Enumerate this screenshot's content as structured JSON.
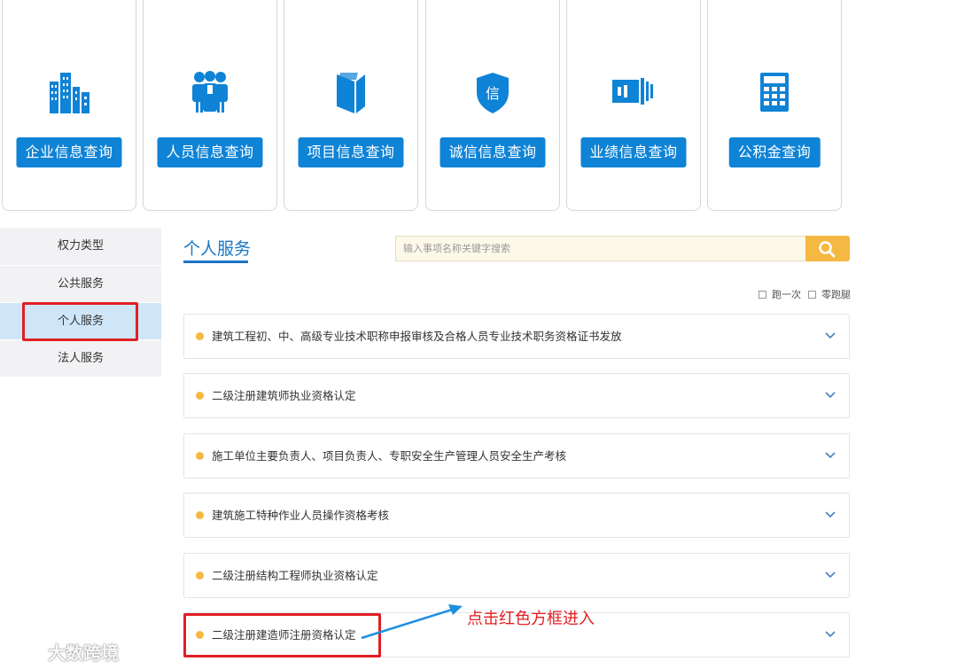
{
  "cards": [
    {
      "label": "企业信息查询",
      "icon": "buildings-icon"
    },
    {
      "label": "人员信息查询",
      "icon": "people-icon"
    },
    {
      "label": "项目信息查询",
      "icon": "book-icon"
    },
    {
      "label": "诚信信息查询",
      "icon": "shield-icon",
      "icon_char": "信"
    },
    {
      "label": "业绩信息查询",
      "icon": "flag-icon"
    },
    {
      "label": "公积金查询",
      "icon": "calculator-icon"
    }
  ],
  "sidebar": {
    "items": [
      {
        "label": "权力类型"
      },
      {
        "label": "公共服务"
      },
      {
        "label": "个人服务",
        "active": true
      },
      {
        "label": "法人服务"
      }
    ]
  },
  "main": {
    "title": "个人服务",
    "search_placeholder": "输入事项名称关键字搜索",
    "filters": [
      {
        "label": "跑一次",
        "checked": false
      },
      {
        "label": "零跑腿",
        "checked": false
      }
    ],
    "items": [
      {
        "label": "建筑工程初、中、高级专业技术职称申报审核及合格人员专业技术职务资格证书发放"
      },
      {
        "label": "二级注册建筑师执业资格认定"
      },
      {
        "label": "施工单位主要负责人、项目负责人、专职安全生产管理人员安全生产考核"
      },
      {
        "label": "建筑施工特种作业人员操作资格考核"
      },
      {
        "label": "二级注册结构工程师执业资格认定"
      },
      {
        "label": "二级注册建造师注册资格认定"
      }
    ]
  },
  "annotation": {
    "text": "点击红色方框进入"
  },
  "watermark": {
    "text": "大数跨境"
  },
  "colors": {
    "primary_blue": "#0f83d6",
    "title_blue": "#1a76c6",
    "accent_orange": "#f5b843",
    "highlight_red": "#e11f23",
    "active_bg": "#cfe6f8"
  }
}
